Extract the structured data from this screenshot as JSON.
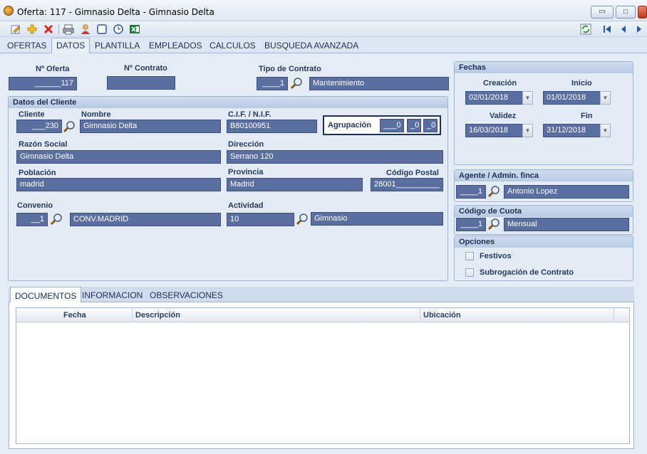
{
  "window": {
    "title": "Oferta: 117 - Gimnasio Delta - Gimnasio Delta",
    "minimize": "▭",
    "maximize": "□",
    "close": "✕"
  },
  "toolbar": {
    "icons": [
      "edit-icon",
      "add-icon",
      "delete-icon",
      "print-icon",
      "user-icon",
      "window-icon",
      "clock-icon",
      "excel-icon",
      "refresh-icon",
      "first-icon",
      "prev-icon",
      "next-icon"
    ]
  },
  "main_tabs": [
    "OFERTAS",
    "DATOS",
    "PLANTILLA",
    "EMPLEADOS",
    "CALCULOS",
    "BUSQUEDA AVANZADA"
  ],
  "header": {
    "oferta_label": "Nº Oferta",
    "oferta_value": "______117",
    "contrato_label": "Nº Contrato",
    "contrato_value": "",
    "tipo_label": "Tipo de Contrato",
    "tipo_code": "____1",
    "tipo_value": "Mantenimiento"
  },
  "cliente": {
    "group_title": "Datos del Cliente",
    "cliente_label": "Cliente",
    "cliente_value": "___230",
    "nombre_label": "Nombre",
    "nombre_value": "Gimnasio Delta",
    "cif_label": "C.I.F. / N.I.F.",
    "cif_value": "B80100951",
    "agrupacion_label": "Agrupación",
    "agrupacion_v1": "___0",
    "agrupacion_v2": "_0",
    "agrupacion_v3": "_0",
    "razon_label": "Razón Social",
    "razon_value": "Gimnasio Delta",
    "direccion_label": "Dirección",
    "direccion_value": "Serrano 120",
    "poblacion_label": "Población",
    "poblacion_value": "madrid",
    "provincia_label": "Provincia",
    "provincia_value": "Madrid",
    "cp_label": "Código Postal",
    "cp_value": "28001__________",
    "convenio_label": "Convenio",
    "convenio_code": "__1",
    "convenio_value": "CONV.MADRID",
    "actividad_label": "Actividad",
    "actividad_code": "10",
    "actividad_value": "Gimnasio"
  },
  "fechas": {
    "group_title": "Fechas",
    "creacion_label": "Creación",
    "creacion_value": "02/01/2018",
    "inicio_label": "Inicio",
    "inicio_value": "01/01/2018",
    "validez_label": "Validez",
    "validez_value": "16/03/2018",
    "fin_label": "Fin",
    "fin_value": "31/12/2018"
  },
  "agente": {
    "group_title": "Agente / Admin. finca",
    "code": "____1",
    "value": "Antonio Lopez"
  },
  "cuota": {
    "group_title": "Código de Cuota",
    "code": "____1",
    "value": "Mensual"
  },
  "opciones": {
    "group_title": "Opciones",
    "festivos": "Festivos",
    "subrogacion": "Subrogación de Contrato"
  },
  "bottom_tabs": [
    "DOCUMENTOS",
    "INFORMACION",
    "OBSERVACIONES"
  ],
  "grid": {
    "columns": [
      "Fecha",
      "Descripción",
      "Ubicación"
    ]
  }
}
